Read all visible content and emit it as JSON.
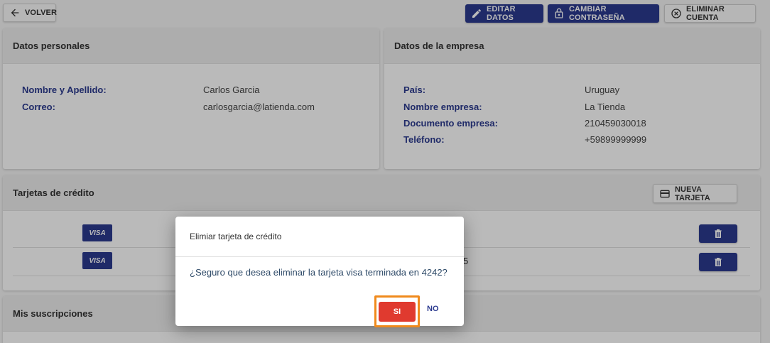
{
  "toolbar": {
    "back_label": "VOLVER",
    "edit_label": "EDITAR DATOS",
    "password_label": "CAMBIAR CONTRASEÑA",
    "delete_account_label": "ELIMINAR CUENTA"
  },
  "personal": {
    "title": "Datos personales",
    "name_label": "Nombre y Apellido:",
    "name_value": "Carlos Garcia",
    "email_label": "Correo:",
    "email_value": "carlosgarcia@latienda.com"
  },
  "company": {
    "title": "Datos de la empresa",
    "country_label": "País:",
    "country_value": "Uruguay",
    "name_label": "Nombre empresa:",
    "name_value": "La Tienda",
    "doc_label": "Documento empresa:",
    "doc_value": "210459030018",
    "phone_label": "Teléfono:",
    "phone_value": "+59899999999"
  },
  "cards": {
    "title": "Tarjetas de crédito",
    "new_card_label": "NUEVA TARJETA",
    "rows": [
      {
        "brand": "VISA",
        "tail": ""
      },
      {
        "brand": "VISA",
        "tail": "5"
      }
    ]
  },
  "subscriptions": {
    "title": "Mis suscripciones"
  },
  "dialog": {
    "title": "Elimiar tarjeta de crédito",
    "message": "¿Seguro que desea eliminar la tarjeta visa terminada en 4242?",
    "confirm_label": "SI",
    "cancel_label": "NO"
  },
  "icons": {
    "back": "arrow-left-icon",
    "edit": "pencil-icon",
    "password": "lock-icon",
    "delete_account": "close-circle-icon",
    "new_card": "credit-card-icon",
    "delete_card": "trash-icon"
  },
  "colors": {
    "primary": "#2b3a8f",
    "danger": "#e03a2f",
    "highlight": "#f08a1c"
  }
}
